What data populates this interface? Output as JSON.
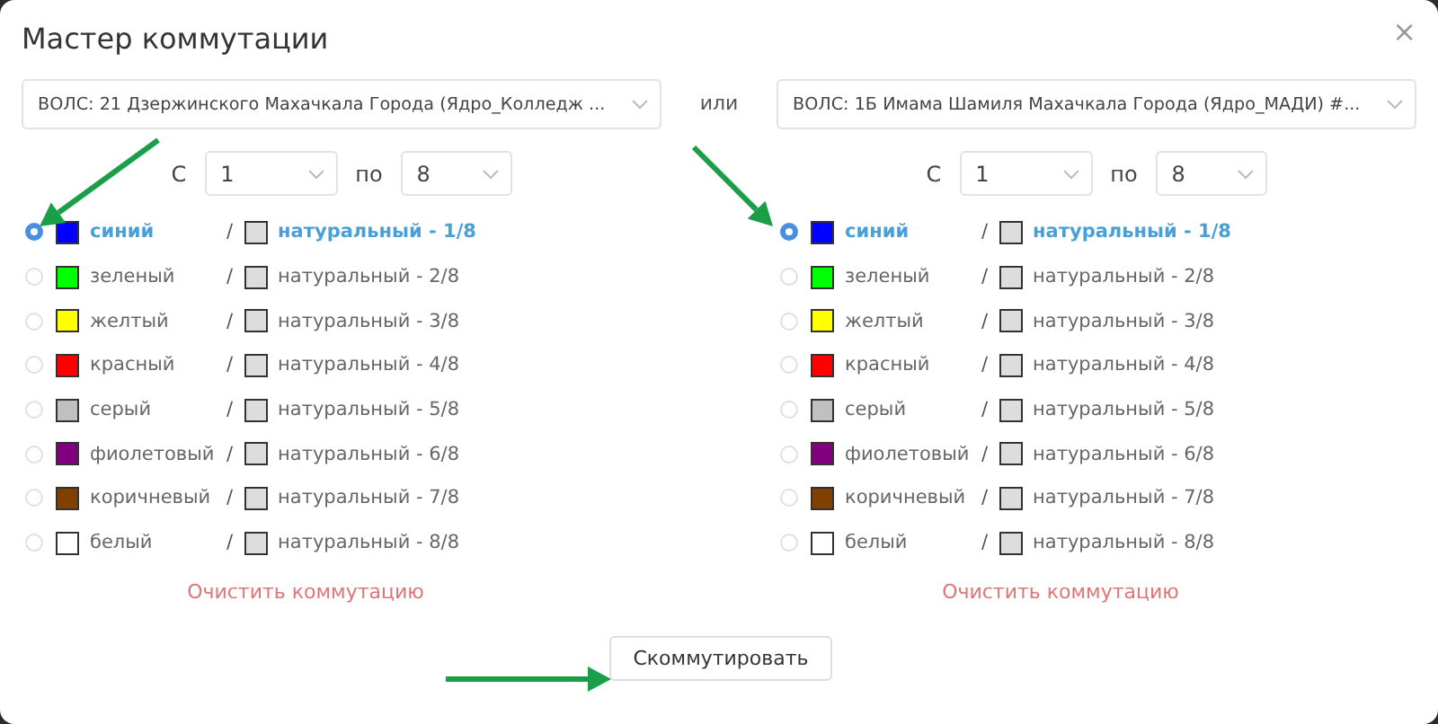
{
  "dialog": {
    "title": "Мастер коммутации",
    "close": "×"
  },
  "separator": "или",
  "panels": [
    {
      "cable": "ВОЛС: 21 Дзержинского Махачкала Города (Ядро_Колледж ...",
      "from_label": "С",
      "from": "1",
      "to_label": "по",
      "to": "8",
      "clear_link": "Очистить коммутацию",
      "fibers": [
        {
          "name": "синий",
          "color": "#0000ff",
          "slash": "/",
          "fiber": "натуральный - 1/8",
          "selected": true
        },
        {
          "name": "зеленый",
          "color": "#00ff00",
          "slash": "/",
          "fiber": "натуральный - 2/8",
          "selected": false
        },
        {
          "name": "желтый",
          "color": "#ffff00",
          "slash": "/",
          "fiber": "натуральный - 3/8",
          "selected": false
        },
        {
          "name": "красный",
          "color": "#ff0000",
          "slash": "/",
          "fiber": "натуральный - 4/8",
          "selected": false
        },
        {
          "name": "серый",
          "color": "#c0c0c0",
          "slash": "/",
          "fiber": "натуральный - 5/8",
          "selected": false
        },
        {
          "name": "фиолетовый",
          "color": "#800080",
          "slash": "/",
          "fiber": "натуральный - 6/8",
          "selected": false
        },
        {
          "name": "коричневый",
          "color": "#804000",
          "slash": "/",
          "fiber": "натуральный - 7/8",
          "selected": false
        },
        {
          "name": "белый",
          "color": "#ffffff",
          "slash": "/",
          "fiber": "натуральный - 8/8",
          "selected": false
        }
      ]
    },
    {
      "cable": "ВОЛС: 1Б Имама Шамиля Махачкала Города (Ядро_МАДИ) #...",
      "from_label": "С",
      "from": "1",
      "to_label": "по",
      "to": "8",
      "clear_link": "Очистить коммутацию",
      "fibers": [
        {
          "name": "синий",
          "color": "#0000ff",
          "slash": "/",
          "fiber": "натуральный - 1/8",
          "selected": true
        },
        {
          "name": "зеленый",
          "color": "#00ff00",
          "slash": "/",
          "fiber": "натуральный - 2/8",
          "selected": false
        },
        {
          "name": "желтый",
          "color": "#ffff00",
          "slash": "/",
          "fiber": "натуральный - 3/8",
          "selected": false
        },
        {
          "name": "красный",
          "color": "#ff0000",
          "slash": "/",
          "fiber": "натуральный - 4/8",
          "selected": false
        },
        {
          "name": "серый",
          "color": "#c0c0c0",
          "slash": "/",
          "fiber": "натуральный - 5/8",
          "selected": false
        },
        {
          "name": "фиолетовый",
          "color": "#800080",
          "slash": "/",
          "fiber": "натуральный - 6/8",
          "selected": false
        },
        {
          "name": "коричневый",
          "color": "#804000",
          "slash": "/",
          "fiber": "натуральный - 7/8",
          "selected": false
        },
        {
          "name": "белый",
          "color": "#ffffff",
          "slash": "/",
          "fiber": "натуральный - 8/8",
          "selected": false
        }
      ]
    }
  ],
  "submit_button": "Скоммутировать"
}
